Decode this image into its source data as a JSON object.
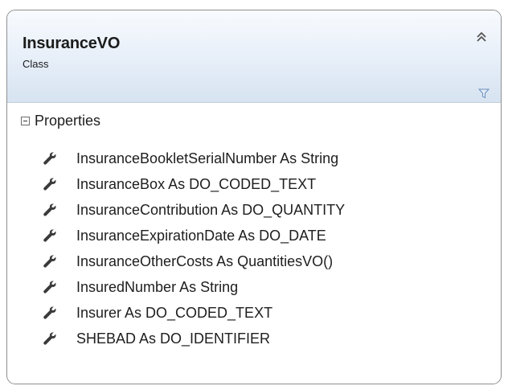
{
  "class": {
    "name": "InsuranceVO",
    "stereotype": "Class"
  },
  "sections": [
    {
      "label": "Properties",
      "expanded": true,
      "members": [
        {
          "text": "InsuranceBookletSerialNumber As String",
          "icon": "wrench-icon"
        },
        {
          "text": "InsuranceBox As DO_CODED_TEXT",
          "icon": "wrench-icon"
        },
        {
          "text": "InsuranceContribution As DO_QUANTITY",
          "icon": "wrench-icon"
        },
        {
          "text": "InsuranceExpirationDate As DO_DATE",
          "icon": "wrench-icon"
        },
        {
          "text": "InsuranceOtherCosts As QuantitiesVO()",
          "icon": "wrench-icon"
        },
        {
          "text": "InsuredNumber As String",
          "icon": "wrench-icon"
        },
        {
          "text": "Insurer As DO_CODED_TEXT",
          "icon": "wrench-icon"
        },
        {
          "text": "SHEBAD As DO_IDENTIFIER",
          "icon": "wrench-icon"
        }
      ]
    }
  ],
  "icons": {
    "collapse": "double-chevron-up-icon",
    "filter": "filter-icon",
    "section_toggle": "minus-box-icon",
    "member": "wrench-icon"
  },
  "colors": {
    "header_top": "#f8fbfe",
    "header_bottom": "#d7e3f1",
    "border": "#8f8f8f",
    "filter_accent": "#6a8fbf"
  }
}
